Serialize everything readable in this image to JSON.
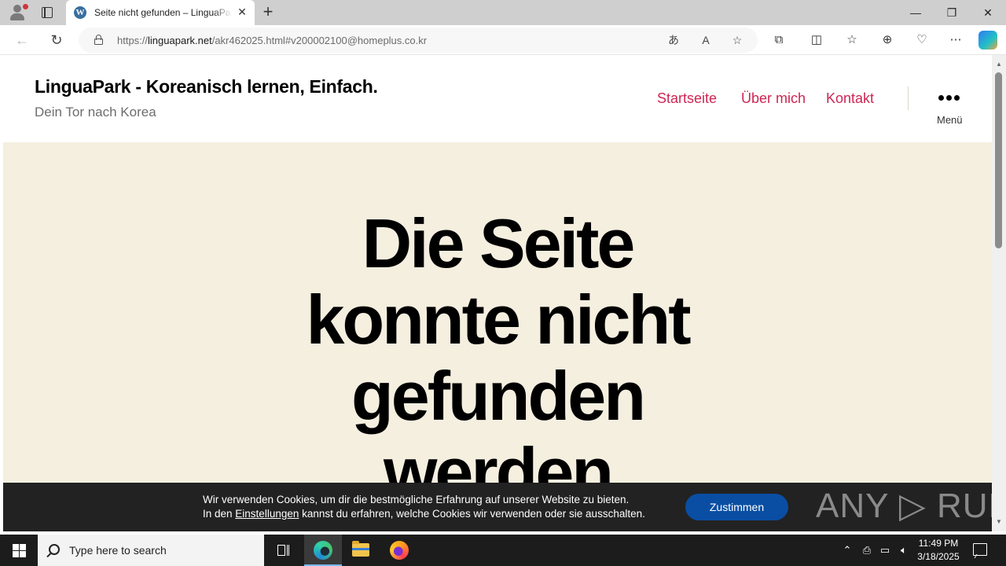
{
  "browser": {
    "tab": {
      "title": "Seite nicht gefunden – LinguaPark - Koreanisch lernen, Einfach."
    },
    "address": {
      "url_prefix": "https://",
      "url_domain": "linguapark.net",
      "url_path": "/akr462025.html#v200002100@homeplus.co.kr"
    },
    "icons": {
      "profile": "profile-icon",
      "tab_actions": "tab-actions-icon",
      "favicon": "wordpress-icon",
      "back": "back-arrow-icon",
      "refresh": "refresh-icon",
      "translate": "translate-icon",
      "read_aloud": "read-aloud-icon",
      "favorite": "star-icon",
      "extensions": "puzzle-icon",
      "split": "split-screen-icon",
      "favorites": "favorites-icon",
      "collections": "collections-icon",
      "performance": "heartbeat-icon",
      "more": "more-icon",
      "copilot": "copilot-icon"
    }
  },
  "site": {
    "title": "LinguaPark - Koreanisch lernen, Einfach.",
    "description": "Dein Tor nach Korea",
    "nav": [
      "Startseite",
      "Über mich",
      "Kontakt"
    ],
    "menu_label": "Menü",
    "accent_color": "#cd2653",
    "hero_bg": "#f5efe0"
  },
  "hero": {
    "heading": "Die Seite konnte nicht gefunden werden"
  },
  "cookie": {
    "line1": "Wir verwenden Cookies, um dir die bestmögliche Erfahrung auf unserer Website zu bieten.",
    "line2_before": "In den ",
    "line2_link": "Einstellungen",
    "line2_after": " kannst du erfahren, welche Cookies wir verwenden oder sie ausschalten.",
    "accept": "Zustimmen",
    "button_color": "#0a4ea3"
  },
  "watermark": "ANY ▷ RUN",
  "taskbar": {
    "search_placeholder": "Type here to search",
    "time": "11:49 PM",
    "date": "3/18/2025"
  }
}
